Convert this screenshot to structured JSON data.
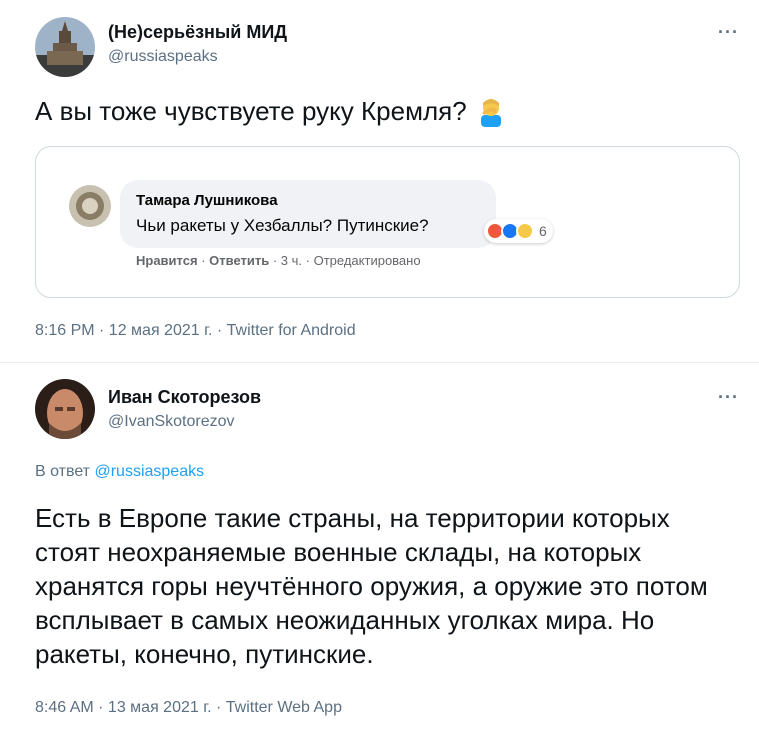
{
  "tweet1": {
    "name": "(Не)серьёзный МИД",
    "handle": "@russiaspeaks",
    "more": "···",
    "text": "А вы тоже чувствуете руку Кремля?",
    "emoji_icon": "facepalm-emoji",
    "embed": {
      "commenter_name": "Тамара Лушникова",
      "comment_text": "Чьи ракеты у Хезбаллы? Путинские?",
      "reaction_count": "6",
      "like_label": "Нравится",
      "reply_label": "Ответить",
      "time_label": "3 ч.",
      "edited_label": "Отредактировано"
    },
    "meta": "8:16 PM · 12 мая 2021 г. · Twitter for Android"
  },
  "tweet2": {
    "name": "Иван Скоторезов",
    "handle": "@IvanSkotorezov",
    "more": "···",
    "reply_prefix": "В ответ",
    "reply_handle": "@russiaspeaks",
    "text": "Есть в Европе такие страны, на территории которых стоят неохраняемые военные склады, на которых хранятся горы неучтённого оружия, а оружие это потом всплывает в самых неожиданных уголках мира. Но ракеты, конечно, путинские.",
    "meta": "8:46 AM · 13 мая 2021 г. · Twitter Web App"
  },
  "colors": {
    "link": "#1da1f2",
    "secondary": "#5b7083",
    "border": "#cfd9de"
  }
}
